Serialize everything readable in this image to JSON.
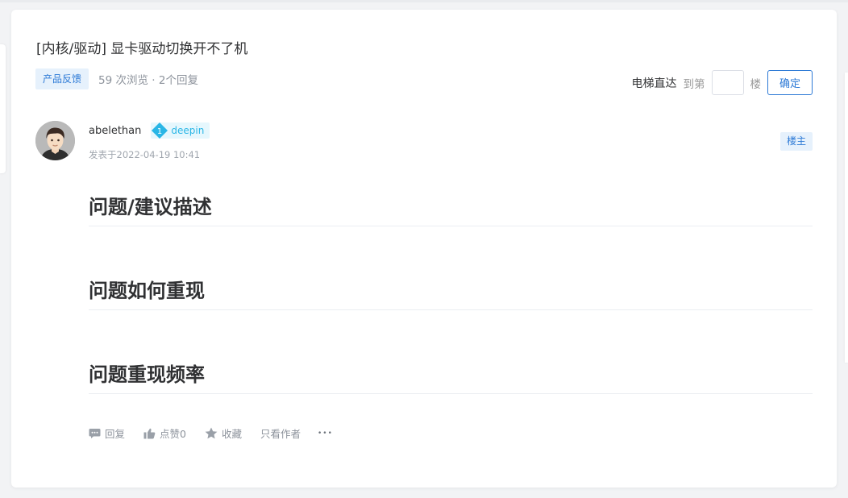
{
  "post": {
    "title": "[内核/驱动] 显卡驱动切换开不了机",
    "category_tag": "产品反馈",
    "stats": "59 次浏览 · 2个回复"
  },
  "elevator": {
    "label": "电梯直达",
    "to_prefix": "到第",
    "floor_value": "",
    "unit": "楼",
    "confirm_label": "确定"
  },
  "author": {
    "name": "abelethan",
    "level": "1",
    "badge_name": "deepin",
    "posted_at": "发表于2022-04-19 10:41",
    "owner_tag": "楼主"
  },
  "content": {
    "headings": [
      "问题/建议描述",
      "问题如何重现",
      "问题重现频率"
    ]
  },
  "actions": {
    "reply": "回复",
    "like": "点赞0",
    "favorite": "收藏",
    "author_only": "只看作者",
    "more": "•••"
  },
  "colors": {
    "accent": "#2d7ad6",
    "level_badge": "#29b6e6",
    "muted_text": "#8d939c"
  },
  "icons": [
    "comment-icon",
    "thumbs-up-icon",
    "star-icon",
    "more-icon",
    "level-diamond-icon"
  ]
}
